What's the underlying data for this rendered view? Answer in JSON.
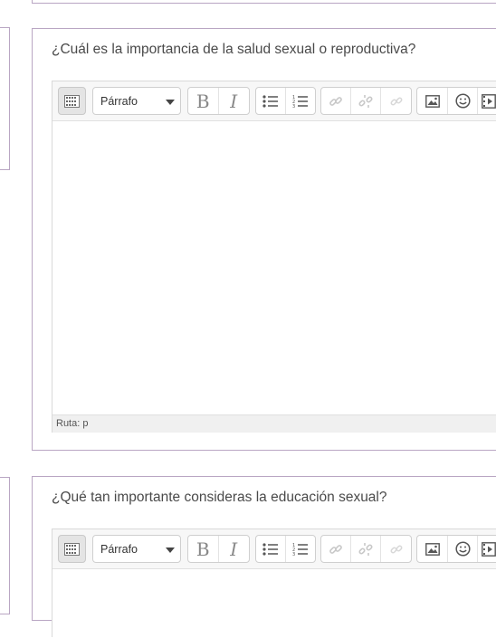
{
  "questions": [
    {
      "title": "¿Cuál es la importancia de la salud sexual o reproductiva?",
      "editor": {
        "format_select": "Párrafo",
        "bold_label": "B",
        "italic_label": "I",
        "path_label": "Ruta: p",
        "icons": [
          "kitchen-sink-icon",
          "bold-icon",
          "italic-icon",
          "unordered-list-icon",
          "ordered-list-icon",
          "link-icon",
          "unlink-icon",
          "anchor-icon",
          "image-icon",
          "emoticon-icon",
          "media-icon"
        ]
      }
    },
    {
      "title": "¿Qué tan importante consideras la educación sexual?",
      "editor": {
        "format_select": "Párrafo",
        "bold_label": "B",
        "italic_label": "I"
      }
    }
  ],
  "colors": {
    "panel_border": "#b9a6c3",
    "toolbar_bg": "#f7f7f7",
    "status_bg": "#f0f0f0"
  }
}
